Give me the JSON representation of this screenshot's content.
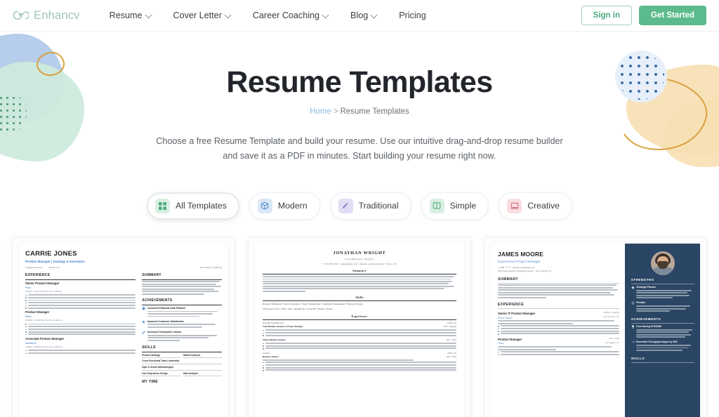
{
  "header": {
    "logo_text": "Enhancv",
    "logo_icon": "infinity-icon",
    "nav": [
      {
        "label": "Resume",
        "has_dropdown": true
      },
      {
        "label": "Cover Letter",
        "has_dropdown": true
      },
      {
        "label": "Career Coaching",
        "has_dropdown": true
      },
      {
        "label": "Blog",
        "has_dropdown": true
      },
      {
        "label": "Pricing",
        "has_dropdown": false
      }
    ],
    "sign_in_label": "Sign in",
    "get_started_label": "Get Started",
    "accent_green": "#5cbb8c",
    "logo_green": "#9fc5b4"
  },
  "hero": {
    "title": "Resume Templates",
    "breadcrumb_home": "Home",
    "breadcrumb_sep": ">",
    "breadcrumb_current": "Resume Templates",
    "description": "Choose a free Resume Template and build your resume. Use our intuitive drag-and-drop resume builder and save it as a PDF in minutes. Start building your resume right now."
  },
  "filters": [
    {
      "label": "All Templates",
      "icon": "grid-icon",
      "active": true,
      "icon_bg": "#d9efe2",
      "icon_fg": "#4aaa7e"
    },
    {
      "label": "Modern",
      "icon": "cube-icon",
      "active": false,
      "icon_bg": "#dbe8f7",
      "icon_fg": "#4a87c9"
    },
    {
      "label": "Traditional",
      "icon": "stamp-icon",
      "active": false,
      "icon_bg": "#e0ddf5",
      "icon_fg": "#6f63bf"
    },
    {
      "label": "Simple",
      "icon": "columns-icon",
      "active": false,
      "icon_bg": "#d9efe2",
      "icon_fg": "#4aaa7e"
    },
    {
      "label": "Creative",
      "icon": "palette-icon",
      "active": false,
      "icon_bg": "#f8dde1",
      "icon_fg": "#cf6678"
    }
  ],
  "templates": [
    {
      "style": "modern-two-column",
      "name": "CARRIE JONES",
      "headline": "Product Manager | Strategy & Innovation",
      "email": "help@enhancv.com",
      "linkedin": "linkedin.com",
      "location": "San Francisco, California",
      "left_sections": [
        {
          "heading": "EXPERIENCE",
          "jobs": [
            {
              "title": "Senior Product Manager",
              "company": "Plaid",
              "meta": "01/2021 - Present     San Francisco, California",
              "bullets": [
                "Led the development and launch of a new financial data integration platform, increasing market penetration by 30% within the first year.",
                "Managed a cross-functional team of 15, including engineers and designers, to deliver the product on time and under budget.",
                "Implemented a customer feedback loop that resulted in a 40% improvement in customer satisfaction scores.",
                "Conducted comprehensive analysis to inform product positioning, leading to a 25% increase in product adoption.",
                "Negotiated partnerships with key financial institutions, expanding the platform's reach and functionality.",
                "Developed and executed a go-to-market strategy that resulted in the product being featured in major tech publications."
              ]
            },
            {
              "title": "Product Manager",
              "company": "Stripe",
              "meta": "06/2018 - 12/2020     San Francisco, California",
              "bullets": [
                "Oversaw the development of a new payment processing feature, resulting in a 20% increase in transaction volume.",
                "Collaborated with the engineering team to streamline the development process, reducing time to market by 30%.",
                "Led user research initiatives that informed product improvements, enhancing user experience and satisfaction.",
                "Managed product backlog and prioritization, ensuring alignment with strategic business goals.",
                "Facilitated cross-departmental communication to align product development with marketing and sales strategies."
              ]
            },
            {
              "title": "Associate Product Manager",
              "company": "Salesforce",
              "meta": "01/2016 - 05/2018     San Francisco, California",
              "bullets": [
                "Contributed to the development of a CRM feature that increased user engagement by 35%.",
                "Assisted in conducting market research and analysis to guide product development strategies."
              ]
            }
          ]
        }
      ],
      "right_sections": [
        {
          "heading": "SUMMARY",
          "body": "With over 7 years of experience in product management, I have a proven track record of driving product strategy and innovation. My expertise in leading cross-functional teams to deliver impactful products aligns with my passion for creating solutions that meet user needs and business goals."
        },
        {
          "heading": "ACHIEVEMENTS",
          "items": [
            {
              "title": "Launched Financial Data Platform",
              "body": "Led the successful launch of a financial data integration platform at Plaid, significantly increasing market penetration."
            },
            {
              "title": "Improved Customer Satisfaction",
              "body": "Implemented a customer feedback loop at Plaid, improving customer satisfaction scores by 40%."
            },
            {
              "title": "Increased Transaction Volume",
              "body": "Developed a new payment processing feature at Stripe, leading to a 20% increase in transaction volume."
            }
          ]
        },
        {
          "heading": "SKILLS",
          "skill_rows": [
            [
              "Product Strategy",
              "Market Analysis"
            ],
            [
              "Cross-Functional Team Leadership"
            ],
            [
              "Agile & Scrum Methodologies"
            ],
            [
              "User Experience Design",
              "Data Analysis"
            ]
          ]
        },
        {
          "heading": "MY TIME"
        }
      ]
    },
    {
      "style": "traditional-serif",
      "name": "JONATHAN WRIGHT",
      "headline": "Lead Business Analyst",
      "contact": "+1 921 989 0541   •   name@gmail.com   •   linkedin.com/in/jonwright   •   Dallas, TX",
      "sections": [
        {
          "heading": "Summary",
          "body": "I am an experienced Business Analyst with a strong technical background and great project management skills. I am able to work on multiple projects at the same time, which over the years at Network Solutions have lead to eight large efficiencies for the business. Furthermore, I immensely enjoy the process of deriving a final business insights, using analytics, and then supporting its delivery managing the with easy implementation projects. My ability to move from analysis to leading a team of analysts to supporting or leading the actual project is something that undeniably further cements the velocity of work at ten insights."
        },
        {
          "heading": "Skills",
          "lines": [
            "Business: Budgeting • Financial Analyses • Project Management • Stakeholder Management • Business Strategy",
            "Technology: Excel • VBA • SQL • QuickBooks • Power BI • Tableau • Python"
          ]
        },
        {
          "heading": "Experience",
          "jobs": [
            {
              "company": "Network Solutions LLC",
              "title": "Lead Business Analyst & Project Manager",
              "right_top": "Dallas, TX",
              "right_bottom": "2019 - Ongoing",
              "bullets": [
                "Created new strategies to manage $1.4 million of corporate AP risk, resulting in an increase of 4% in revenue in 6 months.",
                "Led the effort to deploy an automated client & expense reporting system for more than 70 vendor and affiliate potential scores 3 locations.",
                "Oversaw the budget and schedules of a project in-record, time and over $2C new employees at 2 for new locations."
              ]
            },
            {
              "company": "Senior Business Analyst",
              "title": "",
              "right_top": "2017 - 2019",
              "right_bottom": "",
              "bullets": [
                "Through an improved pricing model, increased gross revenues of 27% in 2018 compared to 2017 with an change in fixed costs.",
                "Reduced warehouse picking time by 40% in just 5 months while industry trend is 18 months.",
                "Achieved project milestones and deliverables with an internal and external team of 104 analysts."
              ]
            },
            {
              "company": "Lexicon",
              "title": "Business Analyst",
              "right_top": "Dallas, TX",
              "right_bottom": "2011 - 2016",
              "body": "Lexicon is a 30-year-old family company in the printing and packaging field with over 150 employees.",
              "bullets": [
                "Prepared 2014 Budget with forecast analysis from last years.",
                "Assisted manager in advanced batch transactions, identifying synergy opportunities of 1.4LM.",
                "Reduced MSG outcome rotation by 2.5% while improving accuracy 5% of 100%.",
                "Designed and maintained 20+ data integration jobs."
              ]
            }
          ]
        }
      ]
    },
    {
      "style": "dark-sidebar-photo",
      "name": "JAMES MOORE",
      "headline": "Experienced Project Manager",
      "phone": "+1 (08) *** ****",
      "email": "jamesmoore@gmail.com",
      "link": "https://www.linkedin.com/in/james-moore",
      "location": "New York City, NY",
      "photo": "profile-photo",
      "main_sections": [
        {
          "heading": "SUMMARY",
          "body": "Result-orientated project team leader with 5 years of experience covering project and product management including developing, implementing and supervising complex infrastructures for fast-growing startups. A fast and eager learner, I am detail-oriented and adapt to changing project requirements quickly to meet business goals. Comfortable with ambiguity and able to thrive in a fast-paced environment."
        },
        {
          "heading": "EXPERIENCE",
          "jobs": [
            {
              "title": "Senior IT Product Manager",
              "company": "Rover Games",
              "right_top": "03/2018 - Ongoing",
              "right_bottom": "San Francisco, CA",
              "body": "Rover Games is a multi-play mobile game app development firm that has successful titles such as Dota Something, Three Knight and King's Night.",
              "bullets": [
                "Accelerated estimated sales cycle by 220% by designing and implementing customer acquisition platform for trading and managing technical sales personnel.",
                "Established and curated strategic partnerships with a suit of 30 top-value communication channels which resulted in $20M additional annual revenue.",
                "Led to architect effort of a cost down product to reduce the platform deployment time for clients by 2 months."
              ]
            },
            {
              "title": "Product Manager",
              "company": "Tesla",
              "right_top": "2017 - 2018",
              "right_bottom": "Los Angeles, CA",
              "body": "Tesla is an electric vehicle manufacturer that is revolutionizing the automobile industry, energy and transportation.",
              "bullets": [
                "Lead a team of developers to build a proprietary CRM system for enterprise and its strategic partners, optimizing sales process and increasing lead conversion."
              ]
            }
          ]
        }
      ],
      "side_sections": [
        {
          "heading": "STRENGTHS",
          "items": [
            {
              "icon": "star-filled-icon",
              "title": "Strategic Planner",
              "body": "Developing ideas along the way to achieve \"big picture\" results with market & stakeholder input."
            },
            {
              "icon": "star-outline-icon",
              "title": "Flexible",
              "body": "Comfortable with ambiguity and able to thrive in fast-paced environments."
            }
          ]
        },
        {
          "heading": "ACHIEVEMENTS",
          "items": [
            {
              "icon": "trophy-icon",
              "title": "Cost Saving Of $100M",
              "body": "Through efficient project management and teamwork, my team saved the division of Tesla over $100 Million in the engine assembly departments."
            },
            {
              "icon": "chart-up-icon",
              "title": "Exceeded Throughput target by 90%",
              "body": "Cutting loading time & fixing key security issues by trimming key vehicle workers, successfully online at scale."
            }
          ]
        },
        {
          "heading": "SKILLS"
        }
      ]
    }
  ]
}
